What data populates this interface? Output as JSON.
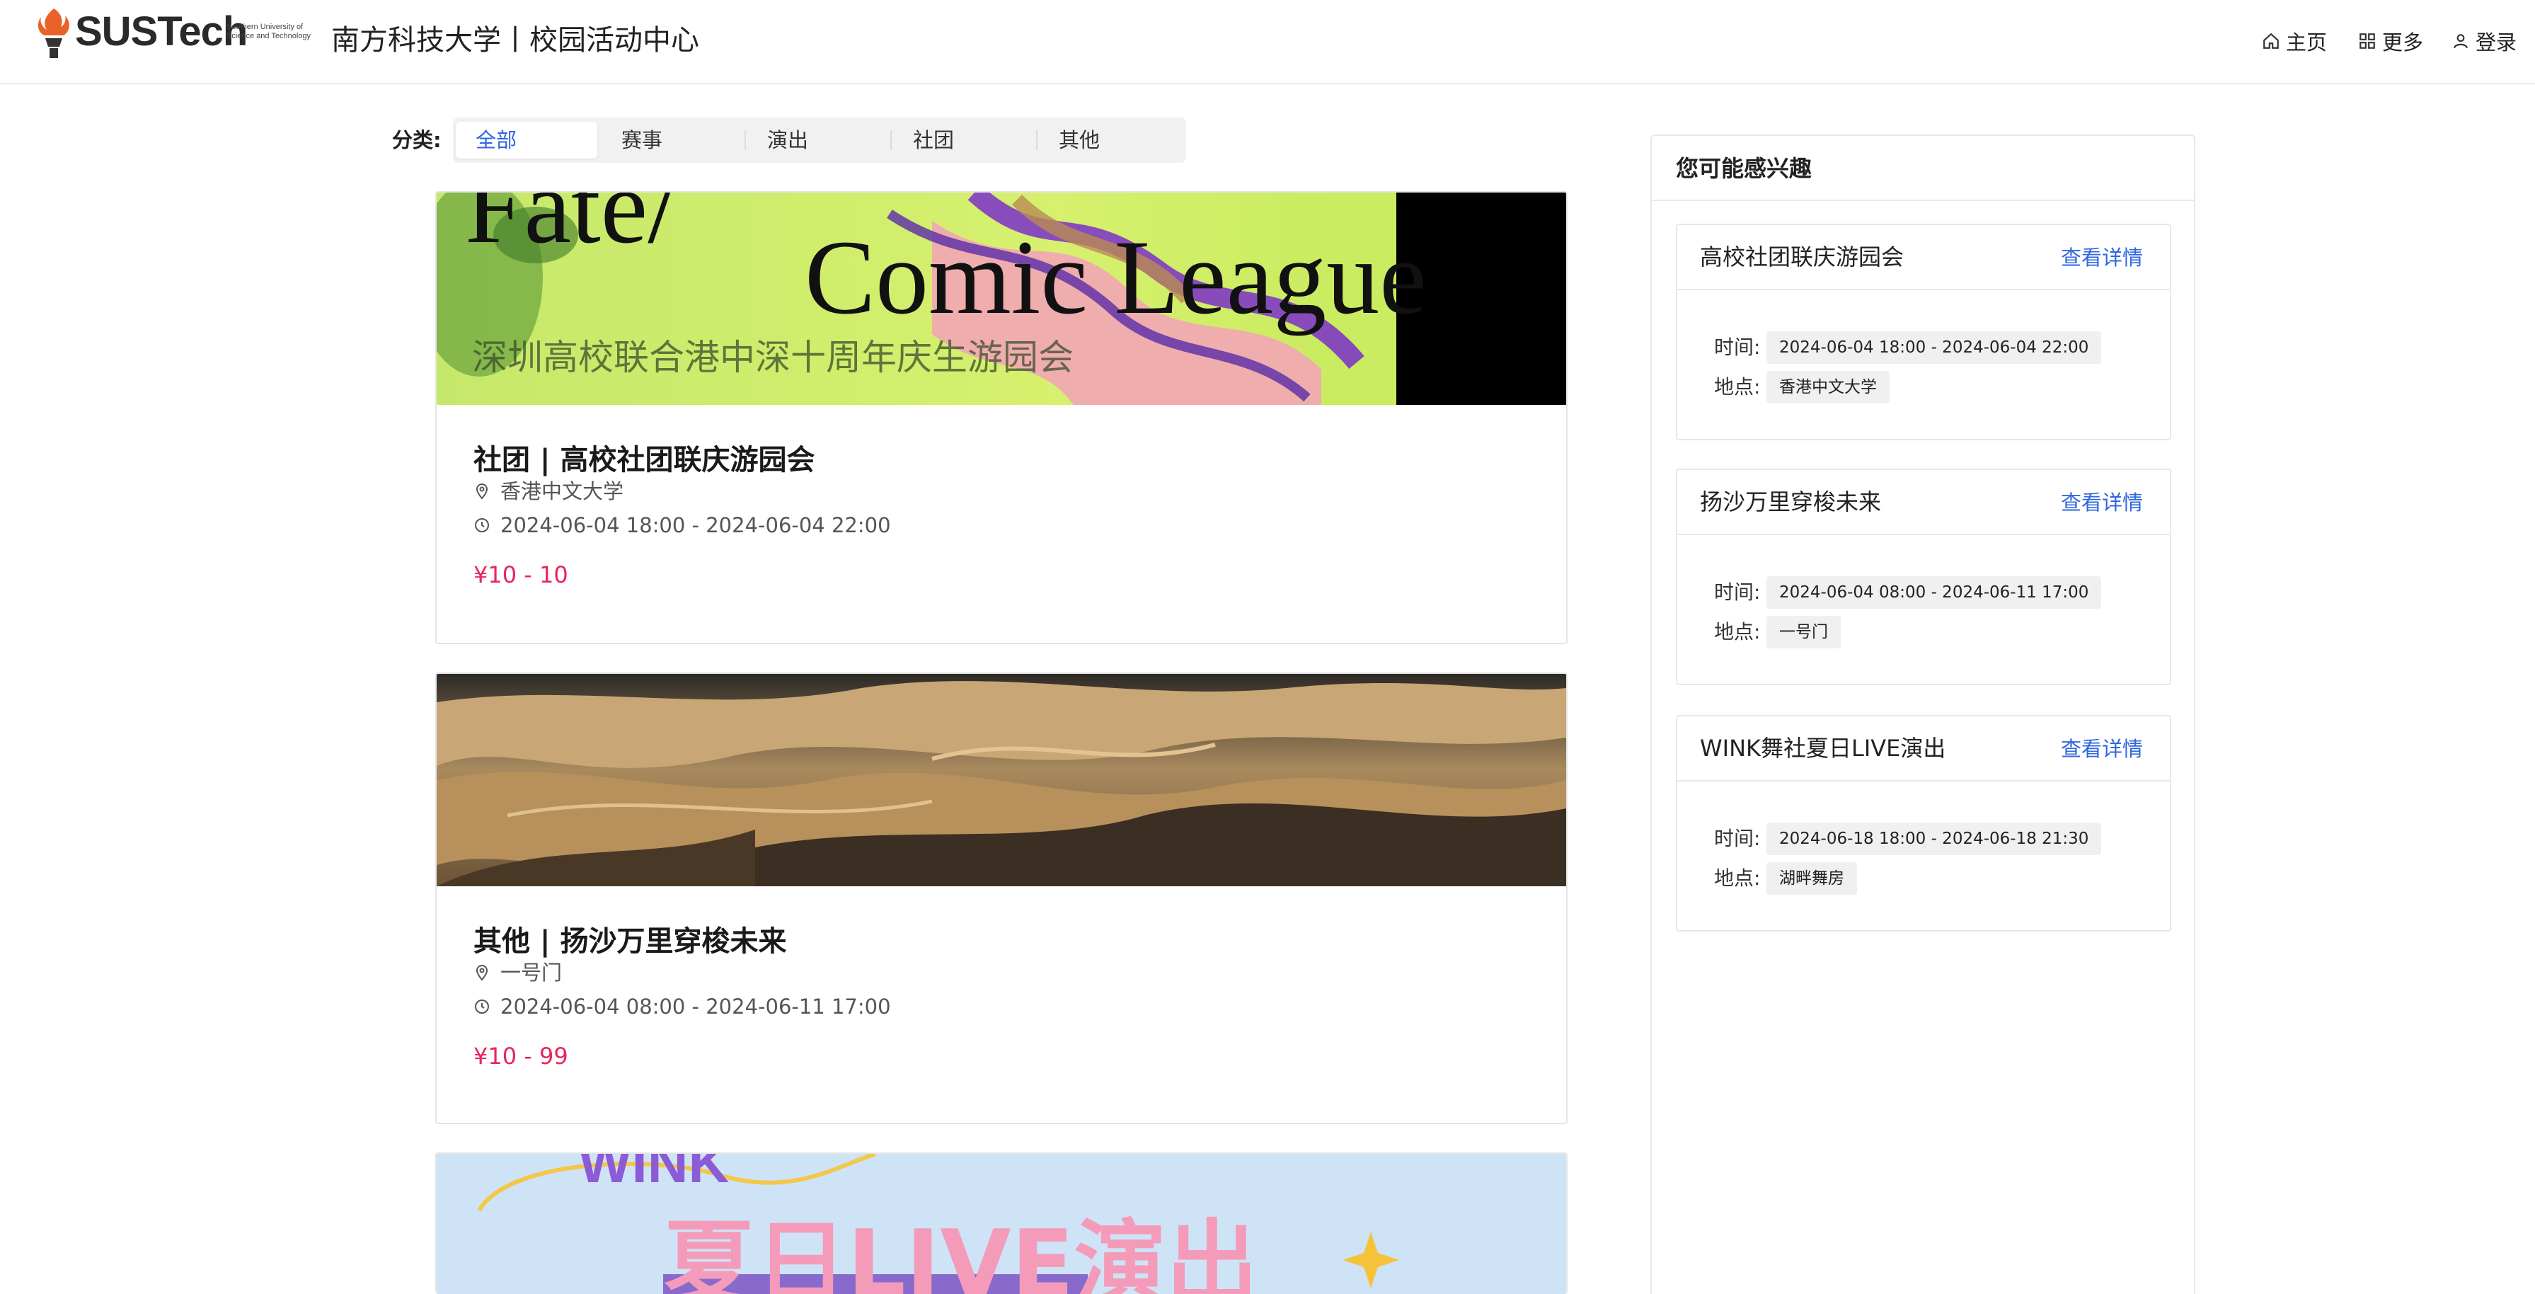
{
  "header": {
    "logo_text": "SUSTech",
    "logo_sub": "Southern University of Science and Technology",
    "site_title": "南方科技大学丨校园活动中心",
    "nav": [
      {
        "label": "主页",
        "icon": "home-icon"
      },
      {
        "label": "更多",
        "icon": "grid-icon"
      },
      {
        "label": "登录",
        "icon": "user-icon"
      }
    ]
  },
  "category": {
    "label": "分类:",
    "items": [
      "全部",
      "赛事",
      "演出",
      "社团",
      "其他"
    ],
    "active": "全部"
  },
  "events": [
    {
      "banner_title": "Fate/ Comic League",
      "banner_subtitle": "深圳高校联合港中深十周年庆生游园会",
      "title": "社团 | 高校社团联庆游园会",
      "location": "香港中文大学",
      "time": "2024-06-04 18:00 - 2024-06-04 22:00",
      "price": "¥10 - 10"
    },
    {
      "banner_title": "",
      "title": "其他 | 扬沙万里穿梭未来",
      "location": "一号门",
      "time": "2024-06-04 08:00 - 2024-06-11 17:00",
      "price": "¥10 - 99"
    },
    {
      "banner_title": "夏日LIVE演出",
      "banner_top": "WINK"
    }
  ],
  "sidebar": {
    "title": "您可能感兴趣",
    "time_key": "时间:",
    "place_key": "地点:",
    "link_label": "查看详情",
    "items": [
      {
        "title": "高校社团联庆游园会",
        "time": "2024-06-04 18:00 - 2024-06-04 22:00",
        "place": "香港中文大学"
      },
      {
        "title": "扬沙万里穿梭未来",
        "time": "2024-06-04 08:00 - 2024-06-11 17:00",
        "place": "一号门"
      },
      {
        "title": "WINK舞社夏日LIVE演出",
        "time": "2024-06-18 18:00 - 2024-06-18 21:30",
        "place": "湖畔舞房"
      }
    ]
  },
  "colors": {
    "accent": "#2f66e0",
    "price": "#e8265c",
    "logo_orange": "#e8632a"
  }
}
